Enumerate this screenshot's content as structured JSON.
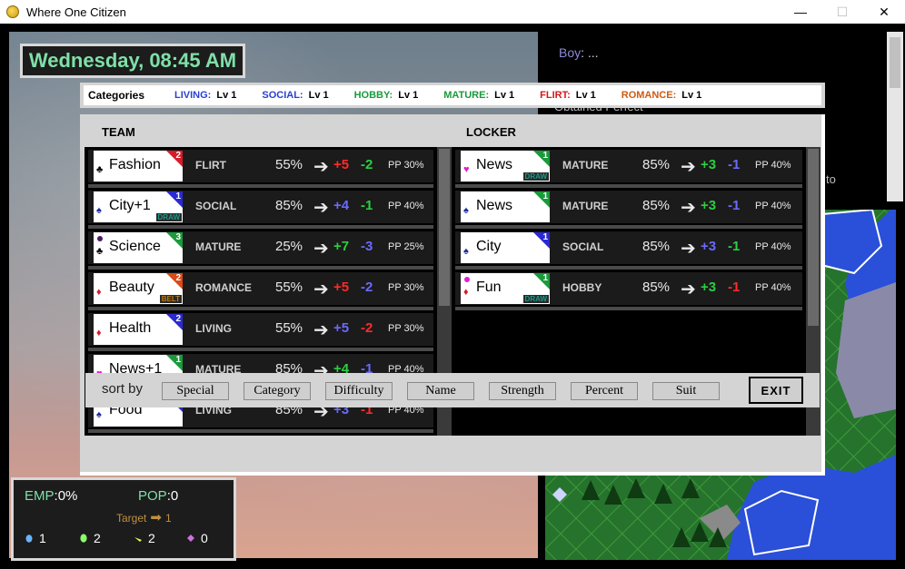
{
  "window": {
    "title": "Where One Citizen",
    "min": "—",
    "max": "☐",
    "close": "✕"
  },
  "date": "Wednesday, 08:45 AM",
  "dialog": {
    "speaker": "Boy",
    "line": ": ...",
    "ghost": "Obtained Perfect",
    "tail_word": "to"
  },
  "categories": {
    "title": "Categories",
    "items": [
      {
        "name": "LIVING:",
        "level": "Lv 1",
        "color": "#2a3fd0"
      },
      {
        "name": "SOCIAL:",
        "level": "Lv 1",
        "color": "#2a3fd0"
      },
      {
        "name": "HOBBY:",
        "level": "Lv 1",
        "color": "#1a9a3a"
      },
      {
        "name": "MATURE:",
        "level": "Lv 1",
        "color": "#1a9a3a"
      },
      {
        "name": "FLIRT:",
        "level": "Lv 1",
        "color": "#d01a1a"
      },
      {
        "name": "ROMANCE:",
        "level": "Lv 1",
        "color": "#d05a10"
      }
    ]
  },
  "team": {
    "heading": "TEAM",
    "scroll_fraction": 0.55,
    "cards": [
      {
        "name": "Fashion",
        "suit": "♣",
        "suit_color": "#000",
        "corner_num": "2",
        "corner_color": "#d81a2a",
        "tag": "",
        "category": "FLIRT",
        "percent": "55%",
        "gain": "+5",
        "gain_color": "#ff2a2a",
        "loss": "-2",
        "loss_color": "#2ad040",
        "pp": "PP 30%"
      },
      {
        "name": "City+1",
        "suit": "♠",
        "suit_color": "#1a2a9a",
        "corner_num": "1",
        "corner_color": "#2a2ad0",
        "tag": "DRAW",
        "category": "SOCIAL",
        "percent": "85%",
        "gain": "+4",
        "gain_color": "#6a6aff",
        "loss": "-1",
        "loss_color": "#2ad040",
        "pp": "PP 40%"
      },
      {
        "name": "Science",
        "suit": "♣",
        "suit_color": "#000",
        "corner_num": "3",
        "corner_color": "#1a9a3a",
        "tag": "",
        "dot": "#4a1a6a",
        "category": "MATURE",
        "percent": "25%",
        "gain": "+7",
        "gain_color": "#2ad040",
        "loss": "-3",
        "loss_color": "#6a6aff",
        "pp": "PP 25%"
      },
      {
        "name": "Beauty",
        "suit": "♦",
        "suit_color": "#d81a2a",
        "corner_num": "2",
        "corner_color": "#d84a1a",
        "tag": "BELT",
        "category": "ROMANCE",
        "percent": "55%",
        "gain": "+5",
        "gain_color": "#ff2a2a",
        "loss": "-2",
        "loss_color": "#6a6aff",
        "pp": "PP 30%"
      },
      {
        "name": "Health",
        "suit": "♦",
        "suit_color": "#d81a2a",
        "corner_num": "2",
        "corner_color": "#2a2ad0",
        "tag": "",
        "category": "LIVING",
        "percent": "55%",
        "gain": "+5",
        "gain_color": "#6a6aff",
        "loss": "-2",
        "loss_color": "#ff2a2a",
        "pp": "PP 30%"
      },
      {
        "name": "News+1",
        "suit": "♥",
        "suit_color": "#e020d0",
        "corner_num": "1",
        "corner_color": "#1a9a3a",
        "tag": "DRAW",
        "category": "MATURE",
        "percent": "85%",
        "gain": "+4",
        "gain_color": "#2ad040",
        "loss": "-1",
        "loss_color": "#6a6aff",
        "pp": "PP 40%"
      },
      {
        "name": "Food",
        "suit": "♠",
        "suit_color": "#1a2a9a",
        "corner_num": "1",
        "corner_color": "#2a2ad0",
        "tag": "",
        "category": "LIVING",
        "percent": "85%",
        "gain": "+3",
        "gain_color": "#6a6aff",
        "loss": "-1",
        "loss_color": "#ff2a2a",
        "pp": "PP 40%"
      }
    ]
  },
  "locker": {
    "heading": "LOCKER",
    "scroll_fraction": 0.62,
    "cards": [
      {
        "name": "News",
        "suit": "♥",
        "suit_color": "#e020d0",
        "corner_num": "1",
        "corner_color": "#1a9a3a",
        "tag": "DRAW",
        "category": "MATURE",
        "percent": "85%",
        "gain": "+3",
        "gain_color": "#2ad040",
        "loss": "-1",
        "loss_color": "#6a6aff",
        "pp": "PP 40%"
      },
      {
        "name": "News",
        "suit": "♠",
        "suit_color": "#1a2a9a",
        "corner_num": "1",
        "corner_color": "#1a9a3a",
        "tag": "",
        "category": "MATURE",
        "percent": "85%",
        "gain": "+3",
        "gain_color": "#2ad040",
        "loss": "-1",
        "loss_color": "#6a6aff",
        "pp": "PP 40%"
      },
      {
        "name": "City",
        "suit": "♠",
        "suit_color": "#1a2a9a",
        "corner_num": "1",
        "corner_color": "#2a2ad0",
        "tag": "",
        "category": "SOCIAL",
        "percent": "85%",
        "gain": "+3",
        "gain_color": "#6a6aff",
        "loss": "-1",
        "loss_color": "#2ad040",
        "pp": "PP 40%"
      },
      {
        "name": "Fun",
        "suit": "♦",
        "suit_color": "#d81a2a",
        "corner_num": "1",
        "corner_color": "#1a9a3a",
        "tag": "DRAW",
        "dot": "#e020d0",
        "category": "HOBBY",
        "percent": "85%",
        "gain": "+3",
        "gain_color": "#2ad040",
        "loss": "-1",
        "loss_color": "#ff2a2a",
        "pp": "PP 40%"
      }
    ]
  },
  "sort": {
    "label": "sort by",
    "buttons": [
      "Special",
      "Category",
      "Difficulty",
      "Name",
      "Strength",
      "Percent",
      "Suit"
    ],
    "exit": "EXIT"
  },
  "stats": {
    "emp_label": "EMP",
    "emp_value": "0%",
    "pop_label": "POP",
    "pop_value": "0",
    "target_label": "Target",
    "target_arrow": "➡",
    "target_value": "1",
    "resources": [
      {
        "icon": "blue-drop-icon",
        "color": "#6ab4ff",
        "value": "1"
      },
      {
        "icon": "green-egg-icon",
        "color": "#8aff6a",
        "value": "2"
      },
      {
        "icon": "leaf-icon",
        "color": "#d8ff5a",
        "value": "2"
      },
      {
        "icon": "pink-gem-icon",
        "color": "#d070e0",
        "value": "0"
      }
    ]
  }
}
